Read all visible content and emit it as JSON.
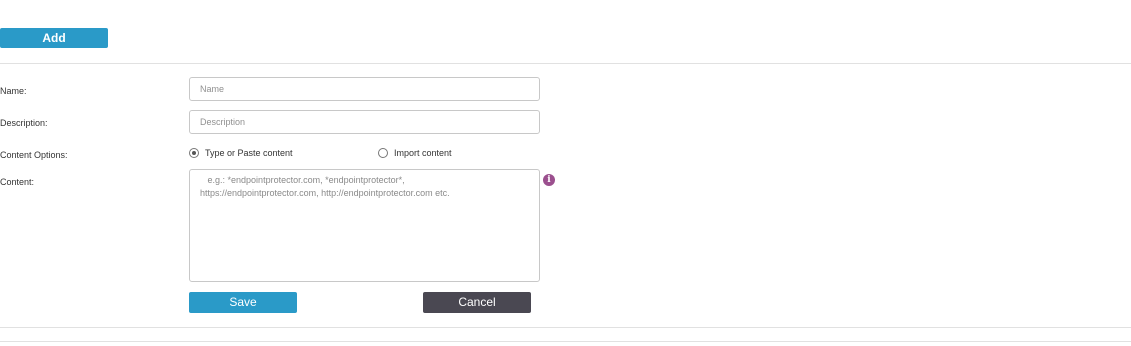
{
  "toolbar": {
    "add_label": "Add"
  },
  "form": {
    "name_label": "Name:",
    "name_placeholder": "Name",
    "description_label": "Description:",
    "description_placeholder": "Description",
    "content_options_label": "Content Options:",
    "option_type_paste": "Type or Paste content",
    "option_import": "Import content",
    "selected_option": "Type or Paste content",
    "content_label": "Content:",
    "content_placeholder": "   e.g.: *endpointprotector.com, *endpointprotector*,\nhttps://endpointprotector.com, http://endpointprotector.com etc.",
    "info_icon": "info-icon",
    "save_label": "Save",
    "cancel_label": "Cancel"
  },
  "colors": {
    "primary": "#2a9ac8",
    "dark_button": "#4a4852",
    "info_icon": "#9b4f8e"
  }
}
